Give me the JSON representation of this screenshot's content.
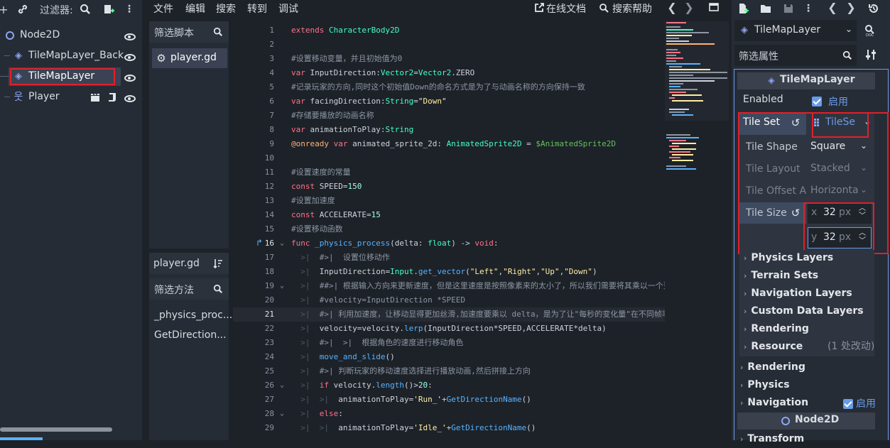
{
  "scene": {
    "filter_label": "过滤器:",
    "nodes": [
      {
        "name": "Node2D"
      },
      {
        "name": "TileMapLayer_Back"
      },
      {
        "name": "TileMapLayer"
      },
      {
        "name": "Player"
      }
    ]
  },
  "menu": {
    "items": [
      "文件",
      "编辑",
      "搜索",
      "转到",
      "调试"
    ],
    "online_docs": "在线文档",
    "search_help": "搜索帮助"
  },
  "scripts": {
    "filter_placeholder": "筛选脚本",
    "files": [
      "player.gd"
    ],
    "current": "player.gd",
    "methods_filter_placeholder": "筛选方法",
    "methods": [
      "_physics_proc...",
      "GetDirection..."
    ]
  },
  "code_lines": [
    {
      "n": "1",
      "html": "<span class='kw'>extends</span> <span class='ty'>CharacterBody2D</span>"
    },
    {
      "n": "2",
      "html": ""
    },
    {
      "n": "3",
      "html": "<span class='cm'>#设置移动变量，并且初始值为0</span>"
    },
    {
      "n": "4",
      "html": "<span class='kw'>var</span> InputDirection:<span class='ty'>Vector2</span>=<span class='ty'>Vector2</span>.ZERO"
    },
    {
      "n": "5",
      "html": "<span class='cm'>#记录玩家的方向,同时这个初始值Down的命名方式是为了与动画名称的方向保持一致</span>"
    },
    {
      "n": "6",
      "html": "<span class='kw'>var</span> facingDirection:<span class='ty'>String</span>=<span class='st'>\"Down\"</span>"
    },
    {
      "n": "7",
      "html": "<span class='cm'>#存储要播放的动画名称</span>"
    },
    {
      "n": "8",
      "html": "<span class='kw'>var</span> animationToPlay:<span class='ty'>String</span>"
    },
    {
      "n": "9",
      "html": "<span class='an'>@onready</span> <span class='kw'>var</span> animated_sprite_2d: <span class='ty'>AnimatedSprite2D</span> = <span class='nd'>$AnimatedSprite2D</span>"
    },
    {
      "n": "10",
      "html": ""
    },
    {
      "n": "11",
      "html": "<span class='cm'>#设置速度的常量</span>"
    },
    {
      "n": "12",
      "html": "<span class='kw'>const</span> SPEED=<span class='nm'>150</span>"
    },
    {
      "n": "13",
      "html": "<span class='cm'>#设置加速度</span>"
    },
    {
      "n": "14",
      "html": "<span class='kw'>const</span> ACCELERATE=<span class='nm'>15</span>"
    },
    {
      "n": "15",
      "html": "<span class='cm'>#设置移动函数</span>"
    },
    {
      "n": "16",
      "html": "<span class='kw'>func</span> <span class='fn'>_physics_process</span>(delta: <span class='ty'>float</span>) -> <span class='kw'>void</span>:"
    },
    {
      "n": "17",
      "html": "<span class='tab'>  &gt;|</span>  <span class='cm'>#&gt;|  设置位移动作</span>"
    },
    {
      "n": "18",
      "html": "<span class='tab'>  &gt;|</span>  InputDirection=<span class='ty'>Input</span>.<span class='fn'>get_vector</span>(<span class='st'>\"Left\"</span>,<span class='st'>\"Right\"</span>,<span class='st'>\"Up\"</span>,<span class='st'>\"Down\"</span>)"
    },
    {
      "n": "19",
      "html": "<span class='tab'>  &gt;|</span>  <span class='cm'>##&gt;| 根据输入方向来更新速度，但是这里速度是按照像素来的太小了，所以我们需要将其乘以一个更</span>"
    },
    {
      "n": "20",
      "html": "<span class='tab'>  &gt;|</span>  <span class='cm'>#velocity=InputDirection *SPEED</span>"
    },
    {
      "n": "21",
      "html": "<span class='tab'>  &gt;|</span>  <span class='cm'>#&gt;| 利用加速度，让移动显得更加丝滑,加速度要乘以 delta，是为了让\"每秒的变化量\"在不同帧率下保</span>"
    },
    {
      "n": "22",
      "html": "<span class='tab'>  &gt;|</span>  velocity=velocity.<span class='fn'>lerp</span>(InputDirection*SPEED,ACCELERATE*delta)"
    },
    {
      "n": "23",
      "html": "<span class='tab'>  &gt;|</span>  <span class='cm'>#&gt;|  &gt;|  根据角色的速度进行移动角色</span>"
    },
    {
      "n": "24",
      "html": "<span class='tab'>  &gt;|</span>  <span class='fn'>move_and_slide</span>()"
    },
    {
      "n": "25",
      "html": "<span class='tab'>  &gt;|</span>  <span class='cm'>#&gt;| 判断玩家的移动速度选择进行播放动画,然后拼接上方向</span>"
    },
    {
      "n": "26",
      "html": "<span class='tab'>  &gt;|</span>  <span class='kw'>if</span> velocity.<span class='fn'>length</span>()&gt;<span class='nm'>20</span>:"
    },
    {
      "n": "27",
      "html": "<span class='tab'>  &gt;|</span>  <span class='tab'>&gt;|</span>  animationToPlay=<span class='st'>'Run_'</span>+<span class='fn'>GetDirectionName</span>()"
    },
    {
      "n": "28",
      "html": "<span class='tab'>  &gt;|</span>  <span class='kw'>else</span>:"
    },
    {
      "n": "29",
      "html": "<span class='tab'>  &gt;|</span>  <span class='tab'>&gt;|</span>  animationToPlay=<span class='st'>'Idle_'</span>+<span class='fn'>GetDirectionName</span>()"
    }
  ],
  "inspector": {
    "node_selector": "TileMapLayer",
    "filter_placeholder": "筛选属性",
    "class_title": "TileMapLayer",
    "enabled_label": "Enabled",
    "enabled_value": "启用",
    "tile_set_label": "Tile Set",
    "tile_set_value": "TileSe",
    "tile_shape_label": "Tile Shape",
    "tile_shape_value": "Square",
    "tile_layout_label": "Tile Layout",
    "tile_layout_value": "Stacked",
    "tile_offset_label": "Tile Offset A",
    "tile_offset_value": "Horizonta",
    "tile_size_label": "Tile Size",
    "tile_size_x_axis": "x",
    "tile_size_x": "32",
    "tile_size_y_axis": "y",
    "tile_size_y": "32",
    "tile_size_unit": "px",
    "sub_sections": [
      "Physics Layers",
      "Terrain Sets",
      "Navigation Layers",
      "Custom Data Layers",
      "Rendering"
    ],
    "resource_label": "Resource",
    "resource_note": "(1 处改动)",
    "sections": [
      "Rendering",
      "Physics"
    ],
    "navigation_label": "Navigation",
    "navigation_value": "启用",
    "node2d_title": "Node2D",
    "transform_label": "Transform"
  },
  "colors": {
    "accent": "#699ce8",
    "highlight_box": "#e0202a",
    "editor_bg": "#1d2229",
    "panel_bg": "#262c35"
  }
}
